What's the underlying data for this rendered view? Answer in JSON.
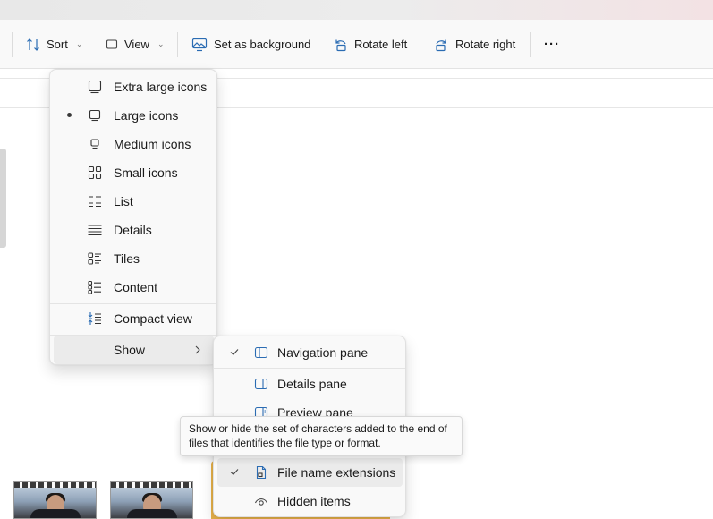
{
  "toolbar": {
    "sort_label": "Sort",
    "view_label": "View",
    "set_background_label": "Set as background",
    "rotate_left_label": "Rotate left",
    "rotate_right_label": "Rotate right",
    "more_label": "···"
  },
  "view_menu": {
    "items": [
      {
        "label": "Extra large icons",
        "icon": "monitor-icon"
      },
      {
        "label": "Large icons",
        "icon": "monitor-icon",
        "selected": true
      },
      {
        "label": "Medium icons",
        "icon": "monitor-small-icon"
      },
      {
        "label": "Small icons",
        "icon": "grid-icon"
      },
      {
        "label": "List",
        "icon": "list-icon"
      },
      {
        "label": "Details",
        "icon": "details-icon"
      },
      {
        "label": "Tiles",
        "icon": "tiles-icon"
      },
      {
        "label": "Content",
        "icon": "content-icon"
      },
      {
        "label": "Compact view",
        "icon": "compact-icon"
      },
      {
        "label": "Show",
        "icon": ""
      }
    ]
  },
  "show_menu": {
    "items": [
      {
        "label": "Navigation pane",
        "checked": true,
        "icon": "navigation-pane-icon"
      },
      {
        "label": "Details pane",
        "checked": false,
        "icon": "details-pane-icon"
      },
      {
        "label": "Preview pane",
        "checked": false,
        "icon": "preview-pane-icon"
      },
      {
        "label": "File name extensions",
        "checked": true,
        "icon": "file-extension-icon"
      },
      {
        "label": "Hidden items",
        "checked": false,
        "icon": "eye-icon"
      }
    ]
  },
  "tooltip": {
    "line1": "Show or hide the set of characters added to the end of",
    "line2": "files that identifies the file type or format."
  },
  "colors": {
    "accent": "#005fb8",
    "menu_bg": "#f9f9f9",
    "hover_bg": "#ebebeb"
  }
}
